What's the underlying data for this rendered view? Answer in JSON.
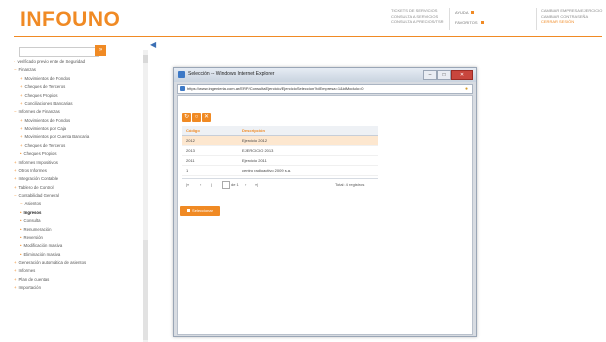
{
  "header": {
    "logo": "INFOUNO",
    "links_col1": [
      "TICKETS DE SERVICIOS",
      "CONSULTA A SERVICIOS",
      "CONSULTA A PRECIOS/TSR"
    ],
    "help_label": "AYUDA",
    "favorites_label": "FAVORITOS",
    "links_col3": [
      "CAMBIAR EMPRESA/EJERCICIO",
      "CAMBIAR CONTRASEÑA",
      "CERRAR SESIÓN"
    ]
  },
  "sidebar": {
    "search_button": "»",
    "items": [
      {
        "label": "verificado previo ente de Seguridad",
        "marker": "·",
        "active": false
      },
      {
        "label": "Finanzas",
        "marker": "−",
        "active": false
      },
      {
        "label": "Movimientos de Fondos",
        "marker": "+",
        "active": false
      },
      {
        "label": "Cheques de Terceros",
        "marker": "+",
        "active": false
      },
      {
        "label": "Cheques Propios",
        "marker": "+",
        "active": false
      },
      {
        "label": "Conciliaciones Bancarias",
        "marker": "+",
        "active": false
      },
      {
        "label": "Informes de Finanzas",
        "marker": "−",
        "active": false
      },
      {
        "label": "Movimientos de Fondos",
        "marker": "+",
        "active": false
      },
      {
        "label": "Movimientos por Caja",
        "marker": "+",
        "active": false
      },
      {
        "label": "Movimientos por Cuenta Bancaria",
        "marker": "+",
        "active": false
      },
      {
        "label": "Cheques de Terceros",
        "marker": "+",
        "active": false
      },
      {
        "label": "Cheques Propios",
        "marker": "•",
        "active": false
      },
      {
        "label": "Informes Impositivos",
        "marker": "+",
        "active": false
      },
      {
        "label": "Otros Informes",
        "marker": "+",
        "active": false
      },
      {
        "label": "Integración Contable",
        "marker": "+",
        "active": false
      },
      {
        "label": "Tablero de Control",
        "marker": "+",
        "active": false
      },
      {
        "label": "Contabilidad General",
        "marker": "−",
        "active": false
      },
      {
        "label": "Asientos",
        "marker": "−",
        "active": false
      },
      {
        "label": "Ingresos",
        "marker": "•",
        "active": true
      },
      {
        "label": "Consulta",
        "marker": "•",
        "active": false
      },
      {
        "label": "Renumeración",
        "marker": "•",
        "active": false
      },
      {
        "label": "Reversión",
        "marker": "•",
        "active": false
      },
      {
        "label": "Modificación masiva",
        "marker": "•",
        "active": false
      },
      {
        "label": "Eliminación masiva",
        "marker": "•",
        "active": false
      },
      {
        "label": "Generación automática de asientos",
        "marker": "+",
        "active": false
      },
      {
        "label": "Informes",
        "marker": "+",
        "active": false
      },
      {
        "label": "Plan de cuentas",
        "marker": "+",
        "active": false
      },
      {
        "label": "Importación",
        "marker": "+",
        "active": false
      }
    ]
  },
  "modal": {
    "title": "Selección -- Windows Internet Explorer",
    "url": "https://www.ingenieria.com.ar/ERP/ConsultaEjercicio/EjercicioSeleccion?idEmpresa=1&idModulo=0",
    "grid": {
      "columns": [
        "Código",
        "Descripción"
      ],
      "rows": [
        [
          "2012",
          "Ejercicio 2012"
        ],
        [
          "2013",
          "EJERCICIO 2013"
        ],
        [
          "2011",
          "Ejercicio 2011"
        ],
        [
          "1",
          "centro radioactivo 2009 s.a."
        ]
      ],
      "selected_row": 0
    },
    "pager": {
      "first": "|«",
      "prev": "‹",
      "page": "1",
      "of_label": "de 1",
      "next": "›",
      "last": "»|",
      "total": "Total: 4 registros"
    },
    "select_button": "Seleccionar"
  },
  "colors": {
    "accent": "#f08a24",
    "ie_blue": "#3d79c6",
    "close_red": "#c9463d"
  }
}
